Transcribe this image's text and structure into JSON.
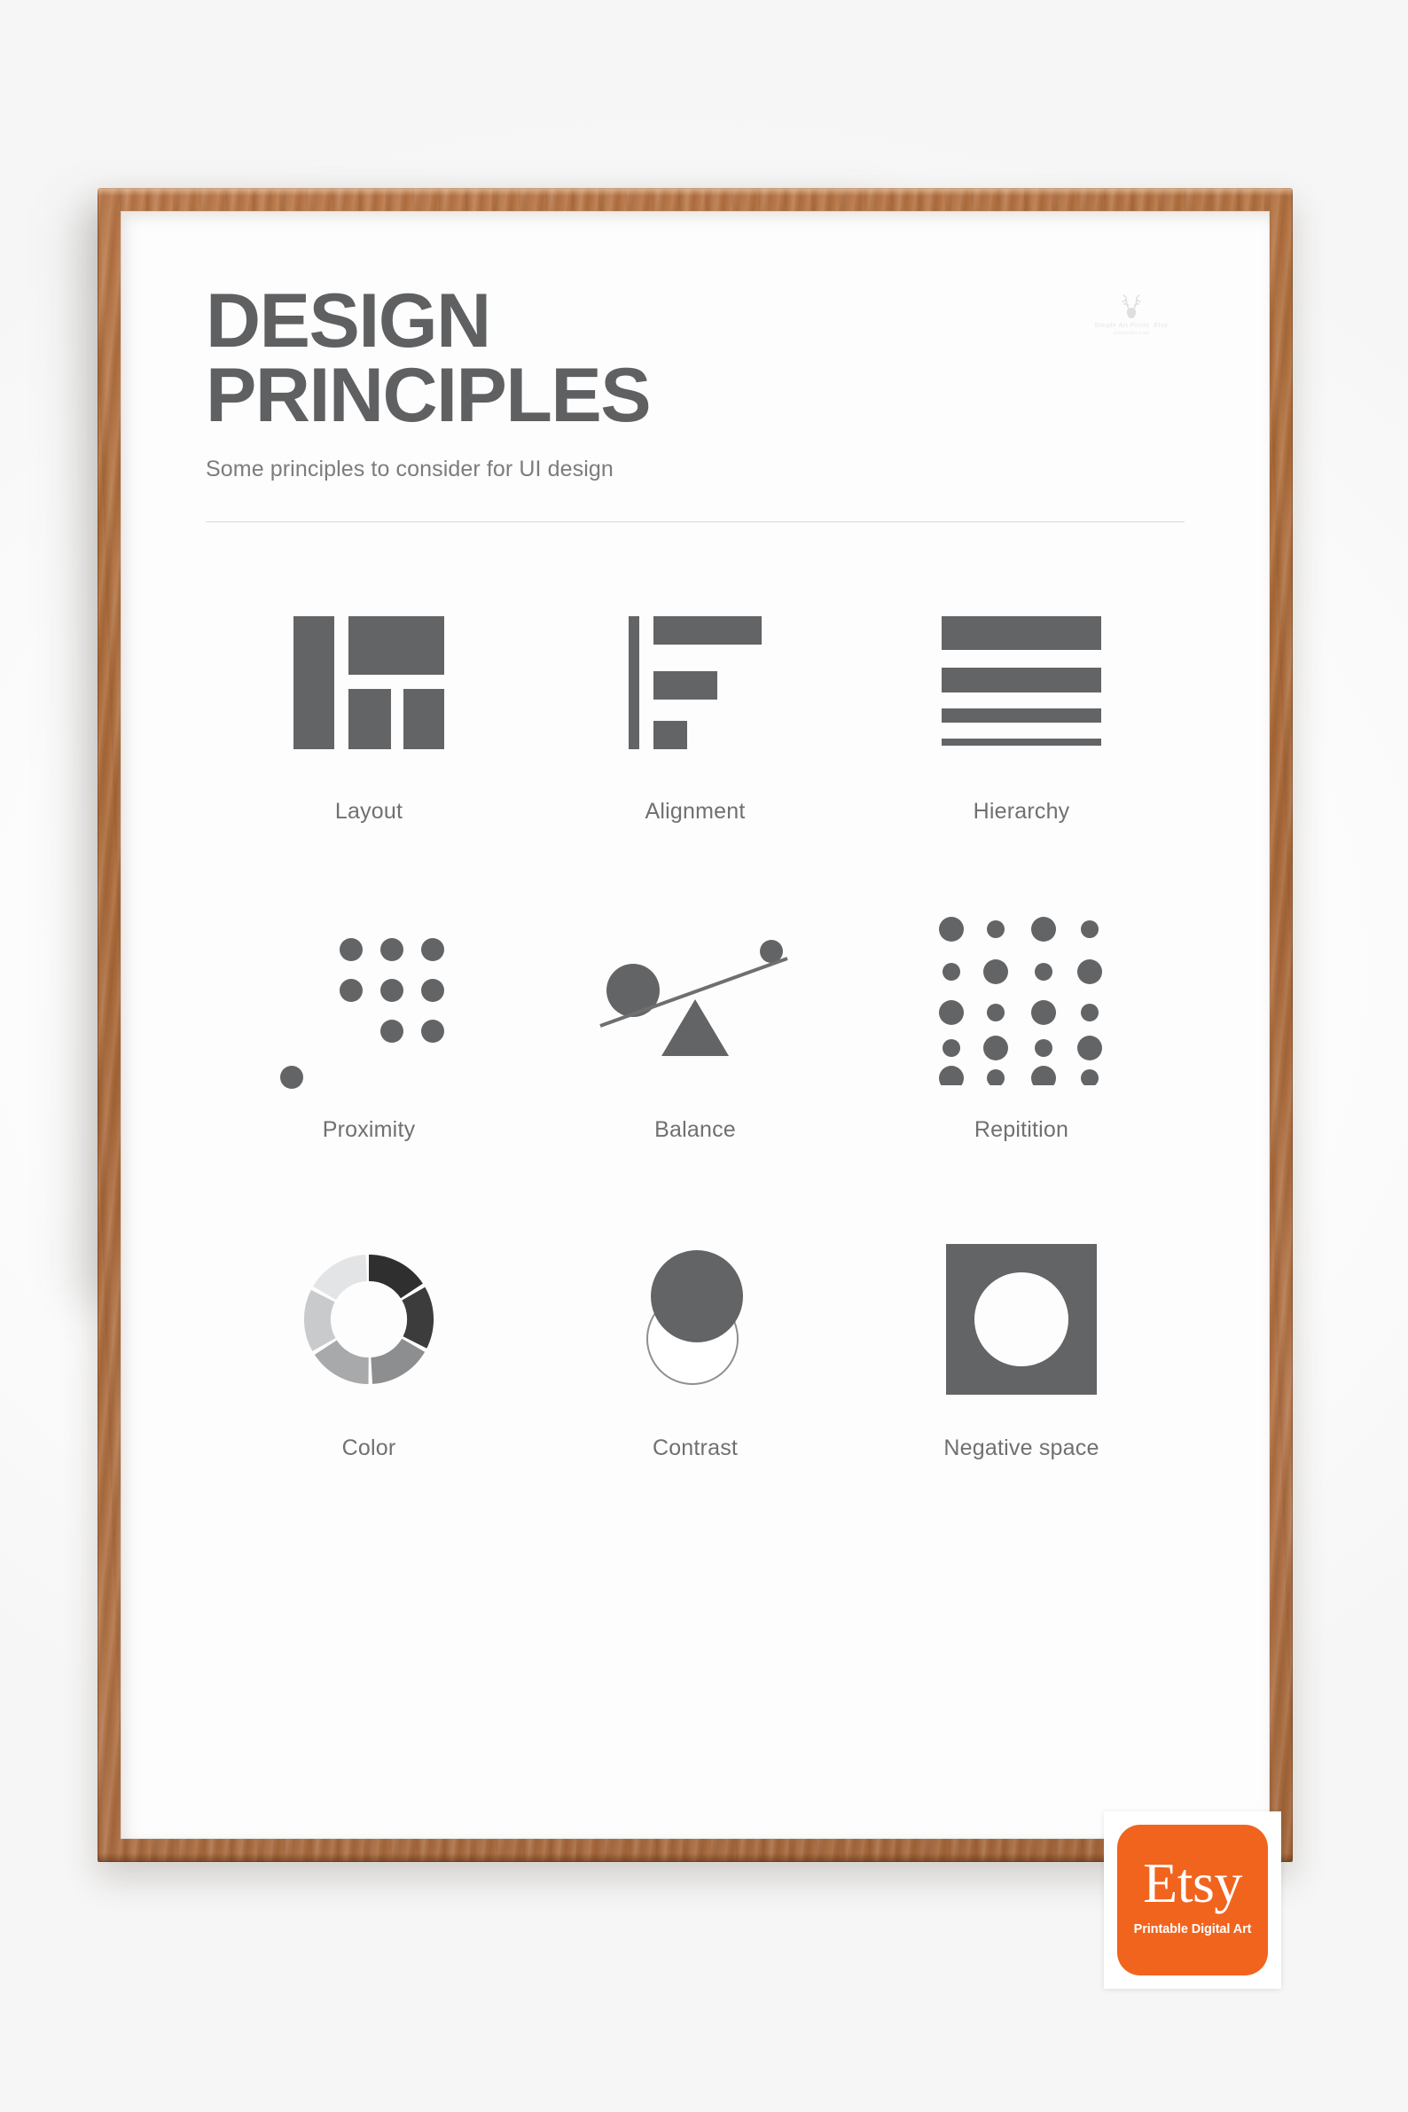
{
  "poster": {
    "title_line1": "DESIGN",
    "title_line2": "PRINCIPLES",
    "subtitle": "Some principles to consider for UI design",
    "brand": {
      "icon": "deer-head-icon",
      "name": "Simple Art Prints .Etsy",
      "tagline": "simpleart.com"
    },
    "principles": [
      {
        "label": "Layout",
        "icon": "layout-blocks-icon"
      },
      {
        "label": "Alignment",
        "icon": "align-left-bars-icon"
      },
      {
        "label": "Hierarchy",
        "icon": "hierarchy-bars-icon"
      },
      {
        "label": "Proximity",
        "icon": "dot-cluster-icon"
      },
      {
        "label": "Balance",
        "icon": "seesaw-balance-icon"
      },
      {
        "label": "Repitition",
        "icon": "dot-grid-icon"
      },
      {
        "label": "Color",
        "icon": "donut-color-wheel-icon"
      },
      {
        "label": "Contrast",
        "icon": "overlapping-circles-icon"
      },
      {
        "label": "Negative space",
        "icon": "square-circle-cutout-icon"
      }
    ]
  },
  "badge": {
    "wordmark": "Etsy",
    "tagline": "Printable Digital Art"
  },
  "colors": {
    "ink": "#5f6062",
    "muted": "#7b7c7e",
    "shape": "#636466",
    "frame_wood": "#ad6d3e",
    "etsy_orange": "#f1641e",
    "rule": "#d8d9da",
    "donut_1": "#2f2f2f",
    "donut_2": "#3c3c3c",
    "donut_3": "#8d8e8f",
    "donut_4": "#a8a9aa",
    "donut_5": "#c9cacb",
    "donut_6": "#e3e4e5"
  }
}
